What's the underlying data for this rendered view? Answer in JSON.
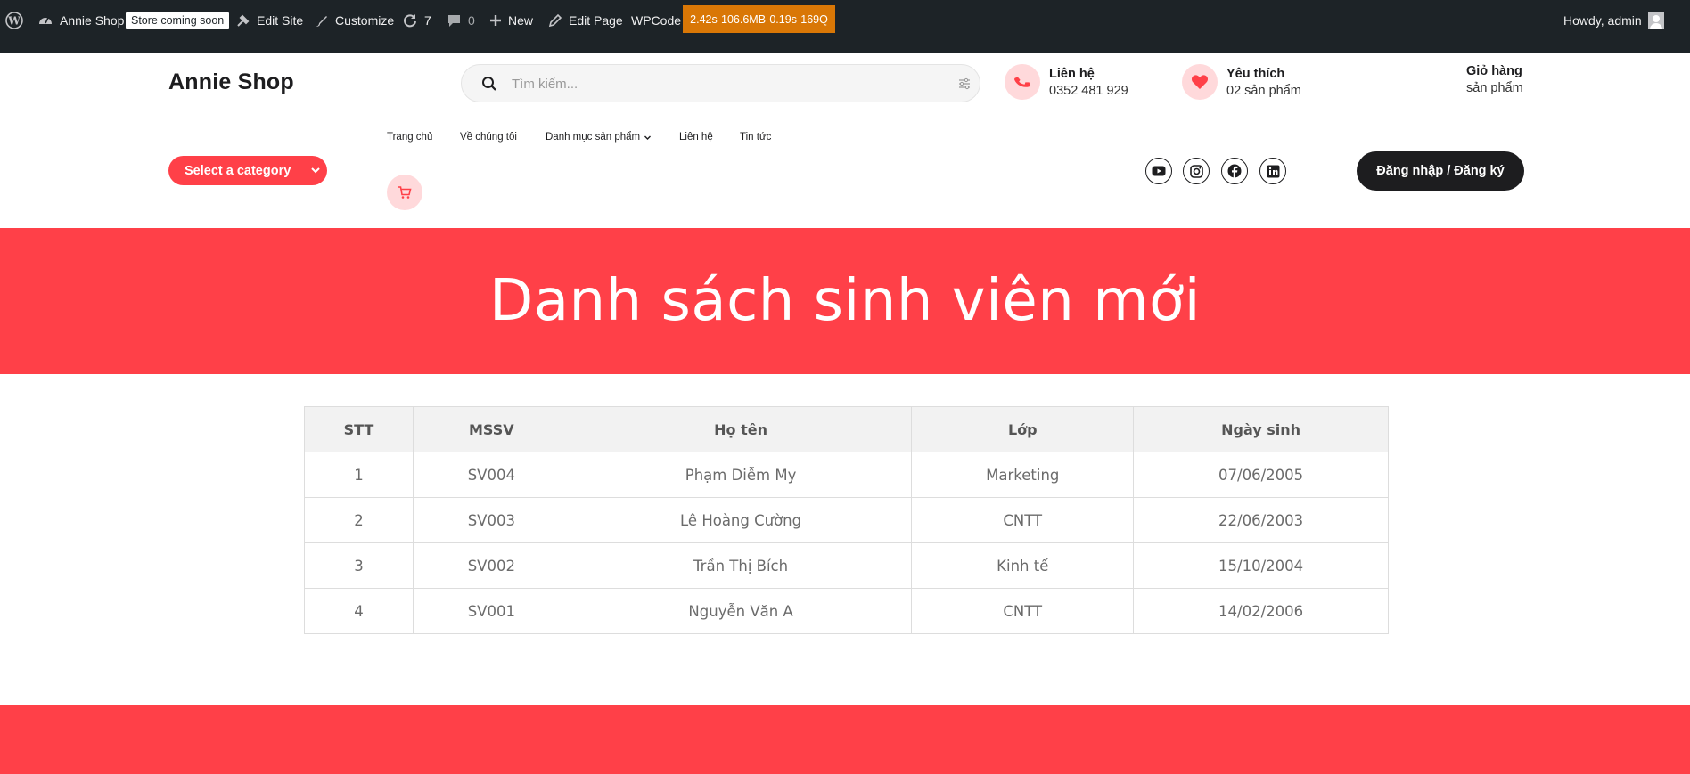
{
  "adminbar": {
    "site_name": "Annie Shop",
    "store_badge": "Store coming soon",
    "edit_site": "Edit Site",
    "customize": "Customize",
    "updates_count": "7",
    "comments_count": "0",
    "new": "New",
    "edit_page": "Edit Page",
    "wpcode": "WPCode",
    "perf": [
      "2.42s",
      "106.6MB",
      "0.19s",
      "169Q"
    ],
    "howdy": "Howdy, admin"
  },
  "header": {
    "logo": "Annie Shop",
    "search_placeholder": "Tìm kiếm...",
    "contact": {
      "label": "Liên hệ",
      "value": "0352 481 929"
    },
    "wishlist": {
      "label": "Yêu thích",
      "value": "02 sản phẩm"
    },
    "cart": {
      "label": "Giỏ hàng",
      "value": "sản phẩm"
    },
    "category_select": "Select a category",
    "nav": [
      "Trang chủ",
      "Về chúng tôi",
      "Danh mục sản phẩm",
      "Liên hệ",
      "Tin tức"
    ],
    "login": "Đăng nhập / Đăng ký"
  },
  "hero": {
    "title": "Danh sách sinh viên mới"
  },
  "table": {
    "headers": [
      "STT",
      "MSSV",
      "Họ tên",
      "Lớp",
      "Ngày sinh"
    ],
    "rows": [
      [
        "1",
        "SV004",
        "Phạm Diễm My",
        "Marketing",
        "07/06/2005"
      ],
      [
        "2",
        "SV003",
        "Lê Hoàng Cường",
        "CNTT",
        "22/06/2003"
      ],
      [
        "3",
        "SV002",
        "Trần Thị Bích",
        "Kinh tế",
        "15/10/2004"
      ],
      [
        "4",
        "SV001",
        "Nguyễn Văn A",
        "CNTT",
        "14/02/2006"
      ]
    ]
  },
  "colors": {
    "accent": "#ff4048",
    "accent_soft": "#ffd9db",
    "dark": "#1d1d1f",
    "adminbar": "#1d2327",
    "perf": "#d97706"
  }
}
